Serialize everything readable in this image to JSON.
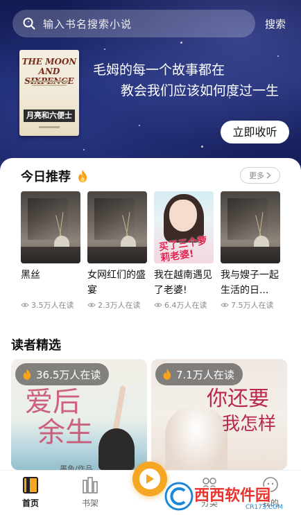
{
  "search": {
    "placeholder": "输入书名搜索小说",
    "button_label": "搜索"
  },
  "hero": {
    "cover_title_en_line1": "THE MOON",
    "cover_title_en_line2": "AND SIXPENCE",
    "cover_title_cn": "月亮和六便士",
    "quote_line1": "毛姆的每一个故事都在",
    "quote_line2": "教会我们应该如何度过一生",
    "listen_label": "立即收听"
  },
  "today": {
    "title": "今日推荐",
    "more_label": "更多",
    "books": [
      {
        "title": "黑丝",
        "reads": "3.5万人在读",
        "cover": "still-life"
      },
      {
        "title": "女网红们的盛宴",
        "reads": "2.3万人在读",
        "cover": "still-life"
      },
      {
        "title": "我在越南遇见了老婆!",
        "reads": "6.4万人在读",
        "cover": "romance",
        "cover_text": "买了三个萝莉老婆!"
      },
      {
        "title": "我与嫂子一起生活的日...",
        "reads": "7.5万人在读",
        "cover": "still-life"
      }
    ]
  },
  "picks": {
    "title": "读者精选",
    "items": [
      {
        "badge": "36.5万人在读",
        "cover_text_1": "爱后",
        "cover_text_2": "余生",
        "author": "墨鱼/作品"
      },
      {
        "badge": "7.1万人在读",
        "cover_text_1": "你还要",
        "cover_text_2": "我怎样"
      }
    ]
  },
  "nav": {
    "items": [
      {
        "label": "首页",
        "icon": "home-book-icon",
        "active": true
      },
      {
        "label": "书架",
        "icon": "bookshelf-icon",
        "active": false
      },
      {
        "label": "分类",
        "icon": "category-icon",
        "active": false
      },
      {
        "label": "我的",
        "icon": "profile-icon",
        "active": false
      }
    ]
  },
  "watermark": {
    "text": "西西软件园",
    "url": "CR173.COM"
  },
  "colors": {
    "accent": "#f5a623",
    "flame": "#f7a21b",
    "hero_bg": "#1d2a6f",
    "romance_title": "#e3234f"
  }
}
